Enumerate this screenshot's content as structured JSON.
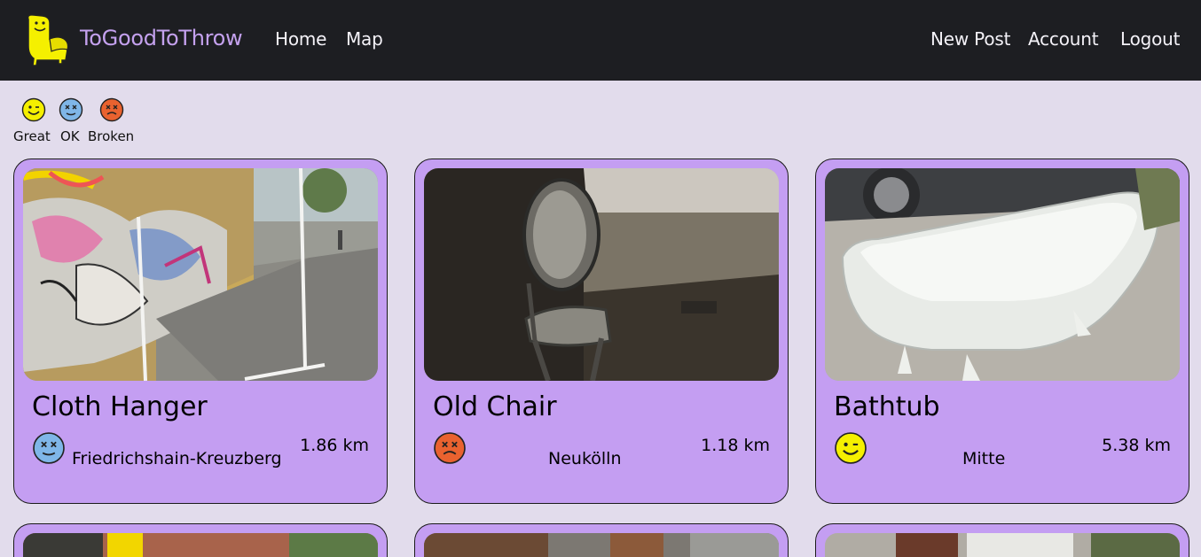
{
  "navbar": {
    "brand": "ToGoodToThrow",
    "links_left": [
      "Home",
      "Map"
    ],
    "links_right": [
      "New Post",
      "Account",
      "Logout"
    ]
  },
  "legend": [
    {
      "label": "Great",
      "icon": "smiley-great-icon",
      "color": "#f5f000"
    },
    {
      "label": "OK",
      "icon": "smiley-ok-icon",
      "color": "#7fb6e8"
    },
    {
      "label": "Broken",
      "icon": "smiley-broken-icon",
      "color": "#e9622f"
    }
  ],
  "posts": [
    {
      "title": "Cloth Hanger",
      "district": "Friedrichshain-Kreuzberg",
      "distance": "1.86 km",
      "condition": "OK",
      "photo": "photo-cloth-hanger"
    },
    {
      "title": "Old Chair",
      "district": "Neukölln",
      "distance": "1.18 km",
      "condition": "Broken",
      "photo": "photo-old-chair"
    },
    {
      "title": "Bathtub",
      "district": "Mitte",
      "distance": "5.38 km",
      "condition": "Great",
      "photo": "photo-bathtub"
    }
  ],
  "colors": {
    "navbar_bg": "#1d1e22",
    "brand": "#c4a1ee",
    "page_bg": "#e2dcec",
    "card_bg": "#c49ef2"
  }
}
